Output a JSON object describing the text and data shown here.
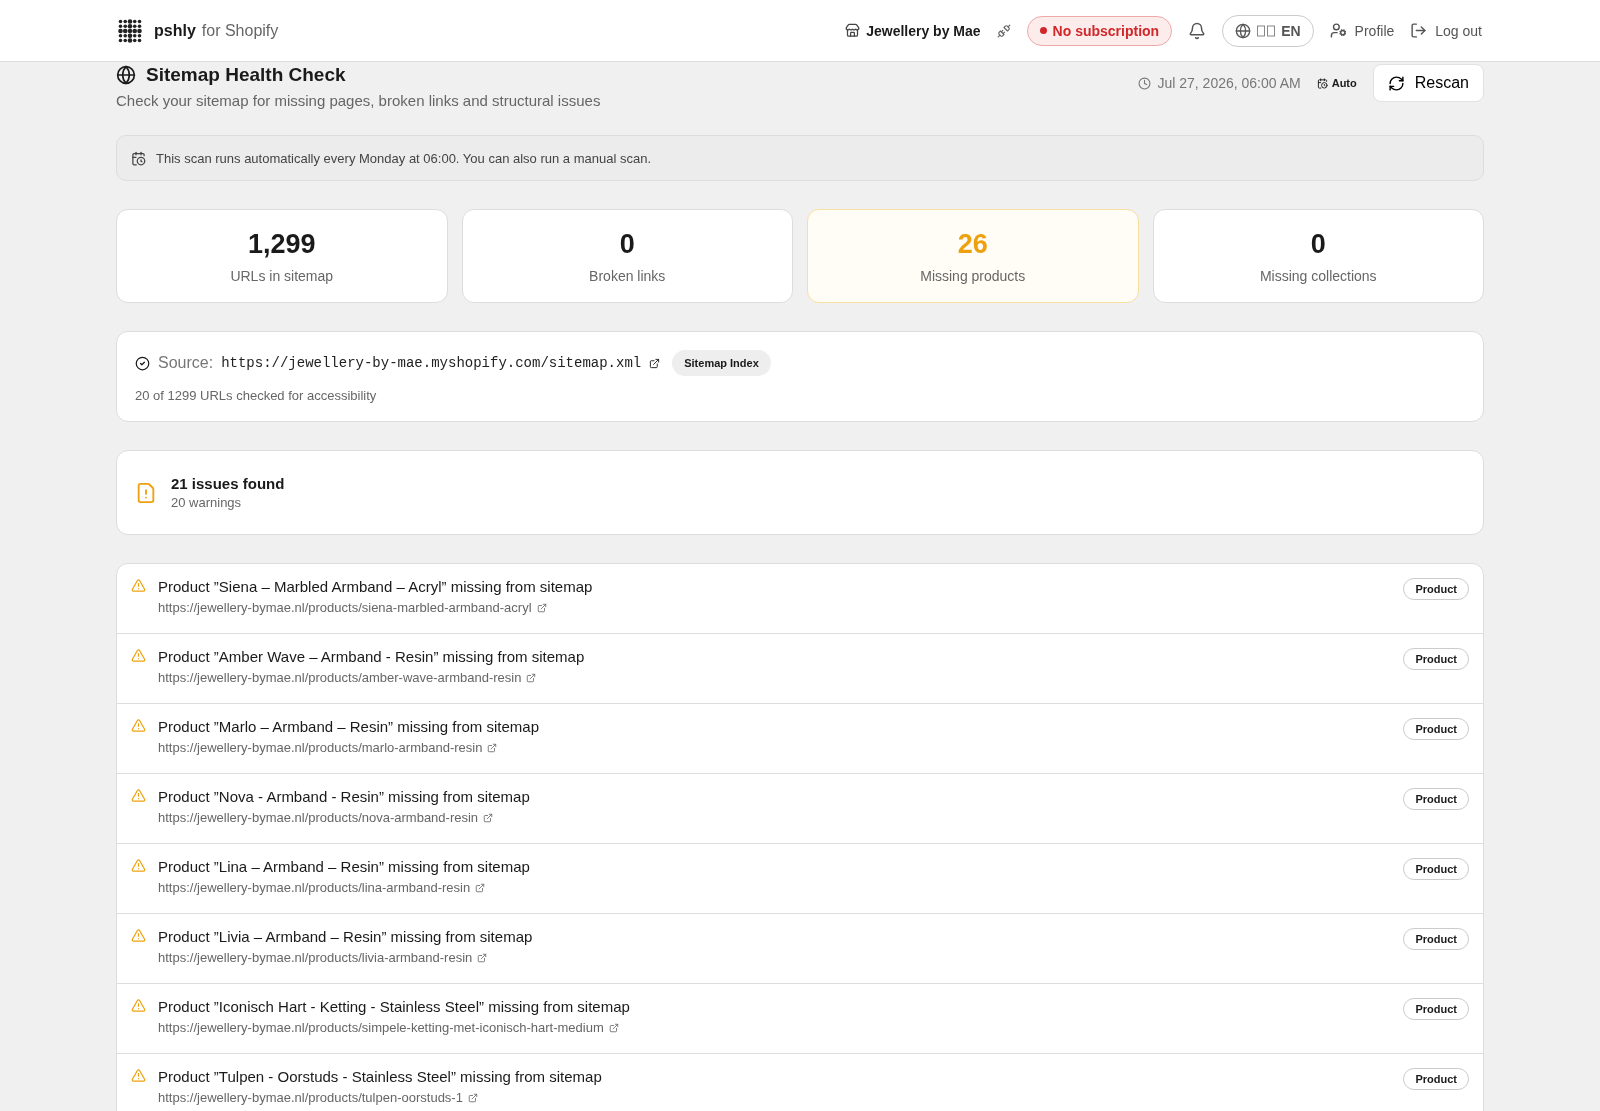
{
  "header": {
    "brand": "pshly",
    "brand_suffix": "for Shopify",
    "store": "Jewellery by Mae",
    "subscription": "No subscription",
    "language": "EN",
    "profile": "Profile",
    "logout": "Log out"
  },
  "page": {
    "title": "Sitemap Health Check",
    "description": "Check your sitemap for missing pages, broken links and structural issues",
    "last_scan": "Jul 27, 2026, 06:00 AM",
    "schedule_badge": "Auto",
    "rescan": "Rescan"
  },
  "banner": "This scan runs automatically every Monday at 06:00. You can also run a manual scan.",
  "stats": [
    {
      "value": "1,299",
      "label": "URLs in sitemap",
      "highlighted": false
    },
    {
      "value": "0",
      "label": "Broken links",
      "highlighted": false
    },
    {
      "value": "26",
      "label": "Missing products",
      "highlighted": true
    },
    {
      "value": "0",
      "label": "Missing collections",
      "highlighted": false
    }
  ],
  "source": {
    "label": "Source:",
    "url": "https://jewellery-by-mae.myshopify.com/sitemap.xml",
    "badge": "Sitemap Index",
    "note": "20 of 1299 URLs checked for accessibility"
  },
  "summary": {
    "title": "21 issues found",
    "subtitle": "20 warnings"
  },
  "issues": [
    {
      "title": "Product ”Siena – Marbled Armband – Acryl” missing from sitemap",
      "url": "https://jewellery-bymae.nl/products/siena-marbled-armband-acryl",
      "tag": "Product"
    },
    {
      "title": "Product ”Amber Wave – Armband - Resin” missing from sitemap",
      "url": "https://jewellery-bymae.nl/products/amber-wave-armband-resin",
      "tag": "Product"
    },
    {
      "title": "Product ”Marlo – Armband – Resin” missing from sitemap",
      "url": "https://jewellery-bymae.nl/products/marlo-armband-resin",
      "tag": "Product"
    },
    {
      "title": "Product ”Nova - Armband - Resin” missing from sitemap",
      "url": "https://jewellery-bymae.nl/products/nova-armband-resin",
      "tag": "Product"
    },
    {
      "title": "Product ”Lina – Armband – Resin” missing from sitemap",
      "url": "https://jewellery-bymae.nl/products/lina-armband-resin",
      "tag": "Product"
    },
    {
      "title": "Product ”Livia – Armband – Resin” missing from sitemap",
      "url": "https://jewellery-bymae.nl/products/livia-armband-resin",
      "tag": "Product"
    },
    {
      "title": "Product ”Iconisch Hart - Ketting - Stainless Steel” missing from sitemap",
      "url": "https://jewellery-bymae.nl/products/simpele-ketting-met-iconisch-hart-medium",
      "tag": "Product"
    },
    {
      "title": "Product ”Tulpen - Oorstuds - Stainless Steel” missing from sitemap",
      "url": "https://jewellery-bymae.nl/products/tulpen-oorstuds-1",
      "tag": "Product"
    }
  ]
}
